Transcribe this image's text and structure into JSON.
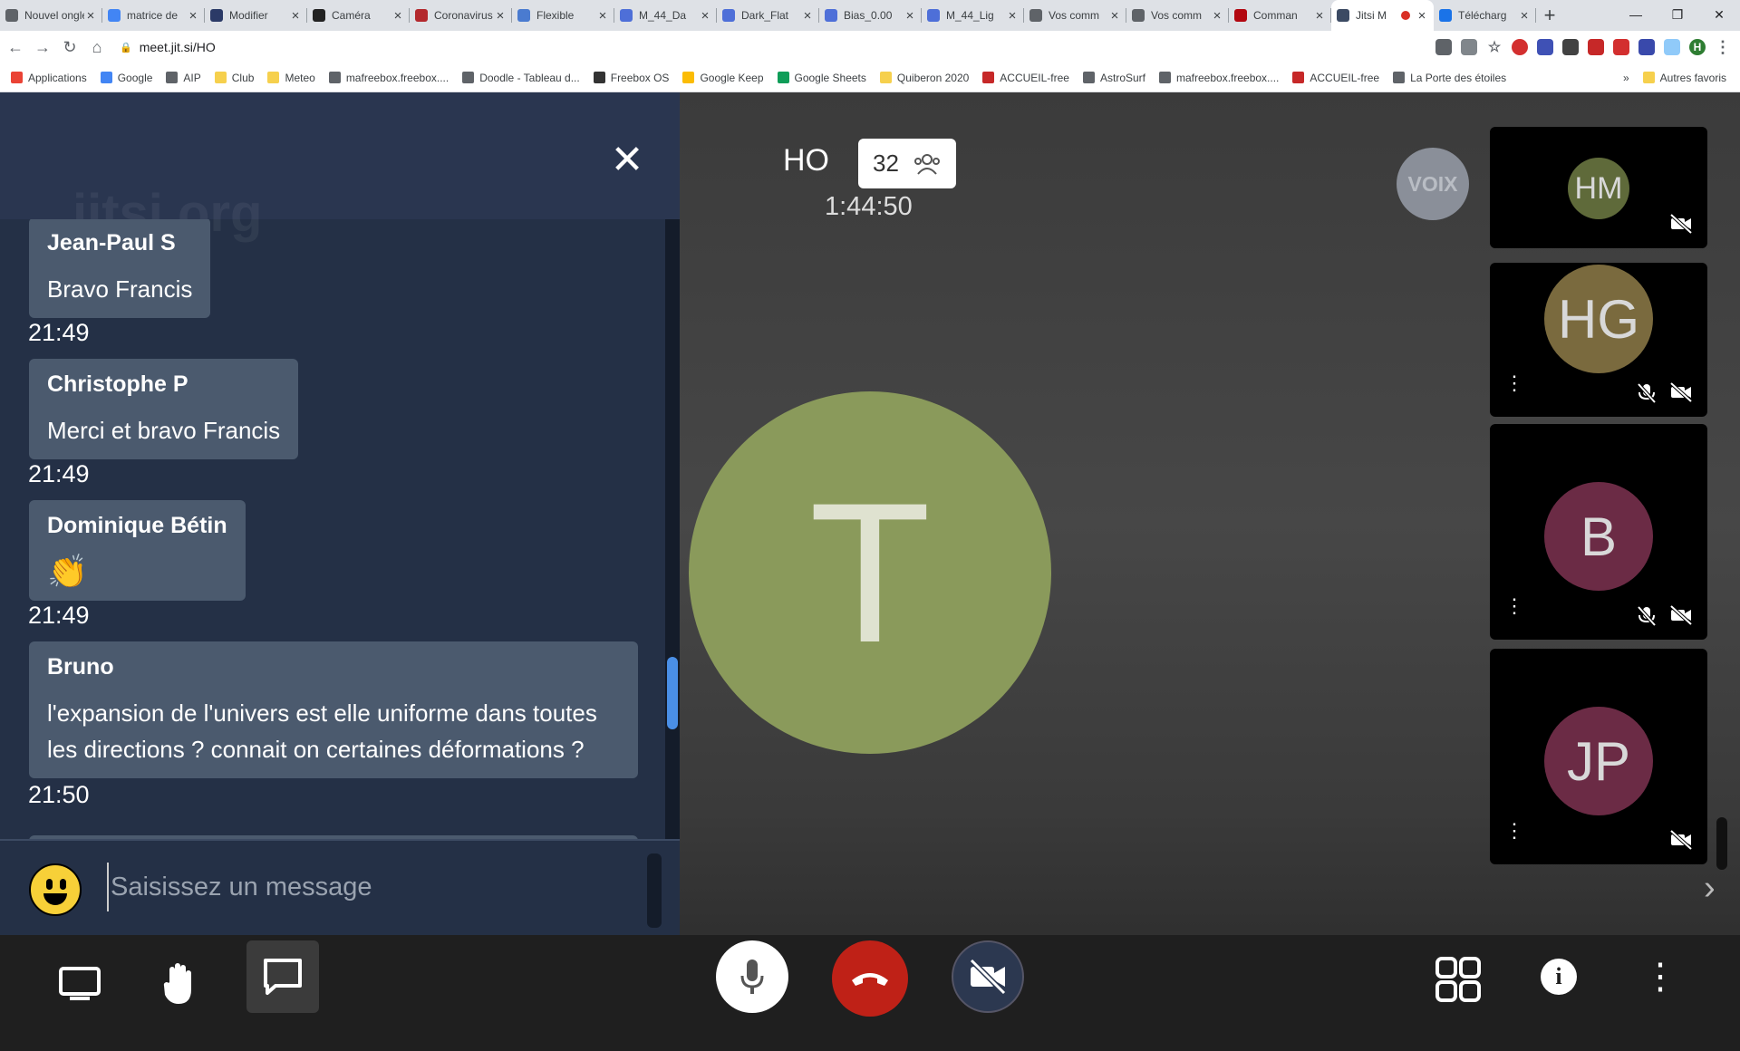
{
  "browser": {
    "tabs": [
      {
        "label": "Nouvel onglet",
        "icon": "page-icon",
        "color": "#5f6368"
      },
      {
        "label": "matrice de",
        "icon": "google-icon",
        "color": "#4285f4"
      },
      {
        "label": "Modifier",
        "icon": "site-icon",
        "color": "#2b3a67"
      },
      {
        "label": "Caméra",
        "icon": "camera-site-icon",
        "color": "#222222"
      },
      {
        "label": "Coronavirus",
        "icon": "news-icon",
        "color": "#b3282d"
      },
      {
        "label": "Flexible",
        "icon": "flexible-icon",
        "color": "#4a7bd0"
      },
      {
        "label": "M_44_Da",
        "icon": "doc-icon",
        "color": "#4e6fd8"
      },
      {
        "label": "Dark_Flat",
        "icon": "doc-icon",
        "color": "#4e6fd8"
      },
      {
        "label": "Bias_0.00",
        "icon": "doc-icon",
        "color": "#4e6fd8"
      },
      {
        "label": "M_44_Lig",
        "icon": "doc-icon",
        "color": "#4e6fd8"
      },
      {
        "label": "Vos comm",
        "icon": "globe-icon",
        "color": "#5f6368"
      },
      {
        "label": "Vos comm",
        "icon": "globe-icon",
        "color": "#5f6368"
      },
      {
        "label": "Comman",
        "icon": "netflix-icon",
        "color": "#b20710"
      },
      {
        "label": "Jitsi M",
        "icon": "jitsi-icon",
        "color": "#3b4a63",
        "active": true
      },
      {
        "label": "Télécharg",
        "icon": "download-icon",
        "color": "#1a73e8"
      }
    ],
    "new_tab": "+",
    "url": "meet.jit.si/HO",
    "profile_initial": "H",
    "bookmarks": [
      {
        "label": "Applications",
        "color": "#ea4335"
      },
      {
        "label": "Google",
        "color": "#4285f4"
      },
      {
        "label": "AIP",
        "color": "#5f6368"
      },
      {
        "label": "Club",
        "color": "#f6d04d"
      },
      {
        "label": "Meteo",
        "color": "#f6d04d"
      },
      {
        "label": "mafreebox.freebox....",
        "color": "#5f6368"
      },
      {
        "label": "Doodle - Tableau d...",
        "color": "#5f6368"
      },
      {
        "label": "Freebox OS",
        "color": "#333333"
      },
      {
        "label": "Google Keep",
        "color": "#fbbc04"
      },
      {
        "label": "Google Sheets",
        "color": "#0f9d58"
      },
      {
        "label": "Quiberon 2020",
        "color": "#f6d04d"
      },
      {
        "label": "ACCUEIL-free",
        "color": "#c62828"
      },
      {
        "label": "AstroSurf",
        "color": "#5f6368"
      },
      {
        "label": "mafreebox.freebox....",
        "color": "#5f6368"
      },
      {
        "label": "ACCUEIL-free",
        "color": "#c62828"
      },
      {
        "label": "La Porte des étoiles",
        "color": "#5f6368"
      }
    ],
    "bookmarks_more": "»",
    "other_bookmarks": "Autres favoris"
  },
  "chat": {
    "watermark": "jitsi.org",
    "messages": [
      {
        "sender": "Jean-Paul S",
        "text": "Bravo Francis",
        "time": "21:49"
      },
      {
        "sender": "Christophe P",
        "text": "Merci et bravo Francis",
        "time": "21:49"
      },
      {
        "sender": "Dominique Bétin",
        "text": "👏",
        "time": "21:49"
      },
      {
        "sender": "Bruno",
        "text": "l'expansion de l'univers est elle uniforme dans toutes les directions ? connait on certaines déformations ?",
        "time": "21:50"
      }
    ],
    "input_placeholder": "Saisissez un message",
    "scroll_position": 0.8
  },
  "conference": {
    "room_name": "HO",
    "participant_count": "32",
    "duration": "1:44:50",
    "voix_badge": "VOIX",
    "main_speaker_initial": "T",
    "main_speaker_color": "#8a9a5b",
    "thumbnails": [
      {
        "initials": "HM",
        "color": "#5f6a3a",
        "muted": false,
        "video_off": true
      },
      {
        "initials": "HG",
        "color": "#7a6a3e",
        "muted": true,
        "video_off": true
      },
      {
        "initials": "B",
        "color": "#6b2b45",
        "muted": true,
        "video_off": true
      },
      {
        "initials": "JP",
        "color": "#6b2b45",
        "muted": false,
        "video_off": true
      }
    ]
  }
}
